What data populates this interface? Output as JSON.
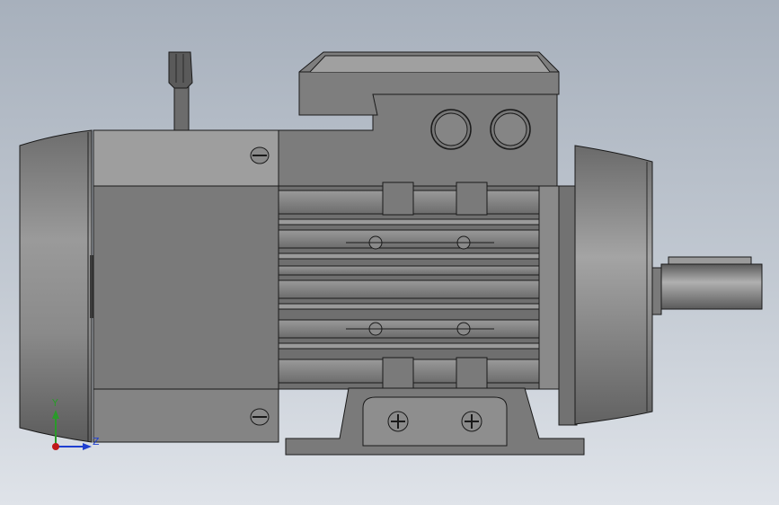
{
  "viewport": {
    "background_top": "#a7b0bc",
    "background_bottom": "#dfe3e9"
  },
  "model": {
    "description_icon": "electric-motor-model",
    "body_color": "#7a7a7a",
    "outline_color": "#1a1a1a"
  },
  "triad": {
    "y_label": "Y",
    "z_label": "Z",
    "y_color": "#2a9a2a",
    "z_color": "#1f3fd0",
    "x_color": "#c01818"
  }
}
